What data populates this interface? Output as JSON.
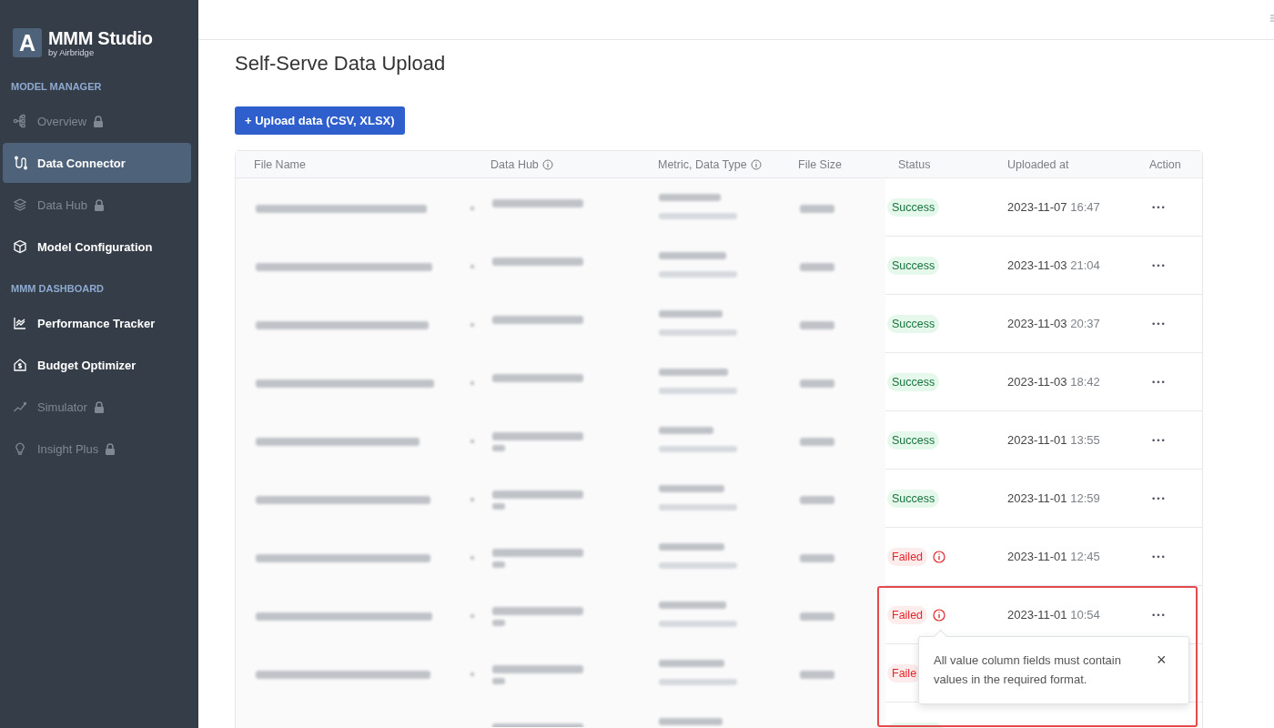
{
  "sidebar": {
    "logo": {
      "letter": "A",
      "title": "MMM Studio",
      "subtitle": "by Airbridge"
    },
    "sections": [
      {
        "title": "MODEL MANAGER",
        "items": [
          {
            "label": "Overview",
            "kind": "nodes",
            "locked": true,
            "selected": false
          },
          {
            "label": "Data Connector",
            "kind": "connector",
            "locked": false,
            "selected": true
          },
          {
            "label": "Data Hub",
            "kind": "layers",
            "locked": true,
            "selected": false
          },
          {
            "label": "Model Configuration",
            "kind": "cube",
            "locked": false,
            "selected": false
          }
        ]
      },
      {
        "title": "MMM DASHBOARD",
        "items": [
          {
            "label": "Performance Tracker",
            "kind": "chart",
            "locked": false,
            "selected": false
          },
          {
            "label": "Budget Optimizer",
            "kind": "house",
            "locked": false,
            "selected": false
          },
          {
            "label": "Simulator",
            "kind": "trend",
            "locked": true,
            "selected": false
          },
          {
            "label": "Insight Plus",
            "kind": "bulb",
            "locked": true,
            "selected": false
          }
        ]
      }
    ]
  },
  "page": {
    "title": "Self-Serve Data Upload",
    "upload_button": "+ Upload data (CSV, XLSX)"
  },
  "table": {
    "columns": [
      {
        "label": "File Name",
        "info": false
      },
      {
        "label": "Data Hub",
        "info": true
      },
      {
        "label": "Metric, Data Type",
        "info": true
      },
      {
        "label": "File Size",
        "info": false
      },
      {
        "label": "Status",
        "info": false
      },
      {
        "label": "Uploaded at",
        "info": false
      },
      {
        "label": "Action",
        "info": false
      }
    ],
    "rows": [
      {
        "status": {
          "kind": "success",
          "label": "Success"
        },
        "date": "2023-11-07",
        "time": "16:47",
        "action": "•••"
      },
      {
        "status": {
          "kind": "success",
          "label": "Success"
        },
        "date": "2023-11-03",
        "time": "21:04",
        "action": "•••"
      },
      {
        "status": {
          "kind": "success",
          "label": "Success"
        },
        "date": "2023-11-03",
        "time": "20:37",
        "action": "•••"
      },
      {
        "status": {
          "kind": "success",
          "label": "Success"
        },
        "date": "2023-11-03",
        "time": "18:42",
        "action": "•••"
      },
      {
        "status": {
          "kind": "success",
          "label": "Success"
        },
        "date": "2023-11-01",
        "time": "13:55",
        "action": "•••"
      },
      {
        "status": {
          "kind": "success",
          "label": "Success"
        },
        "date": "2023-11-01",
        "time": "12:59",
        "action": "•••"
      },
      {
        "status": {
          "kind": "failed",
          "label": "Failed"
        },
        "date": "2023-11-01",
        "time": "12:45",
        "action": "•••"
      },
      {
        "status": {
          "kind": "failed",
          "label": "Failed"
        },
        "date": "2023-11-01",
        "time": "10:54",
        "action": "•••",
        "tooltip": {
          "text": "All value column fields must contain values in the required format.",
          "close": "×"
        }
      },
      {
        "status": {
          "kind": "failed",
          "label": "Faile"
        }
      },
      {
        "status": {
          "kind": "success"
        }
      }
    ]
  },
  "annotation_frame": true
}
